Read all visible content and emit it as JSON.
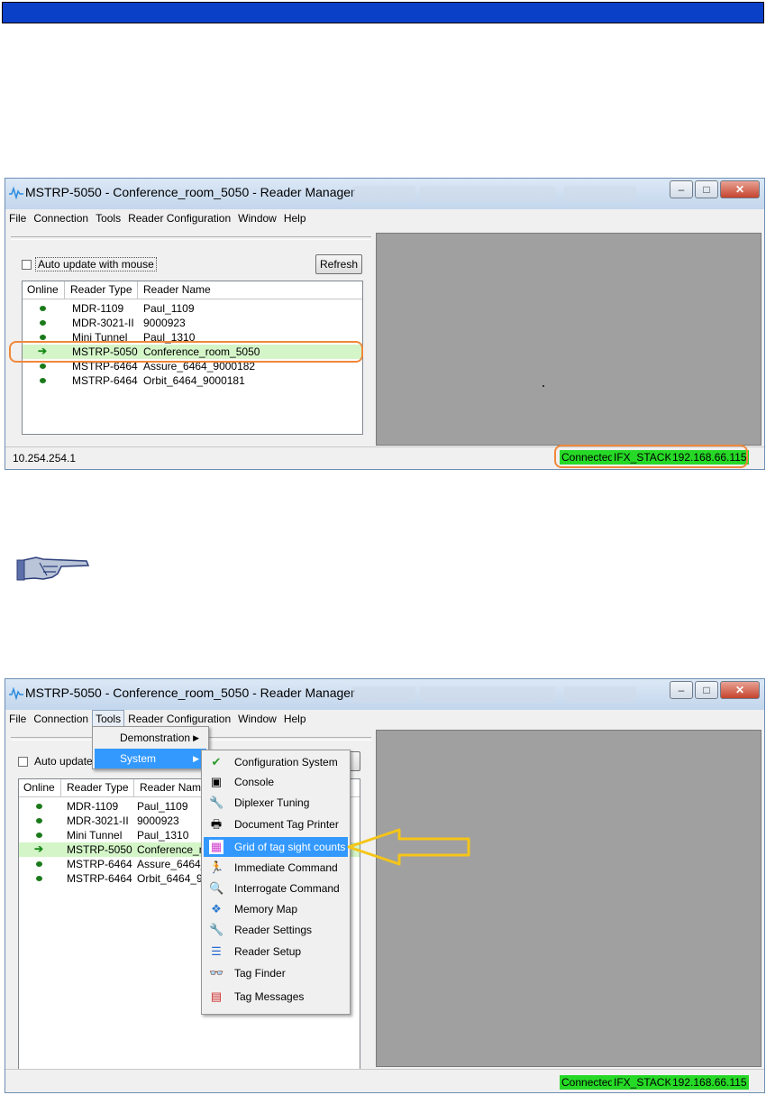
{
  "window": {
    "title": "MSTRP-5050 - Conference_room_5050 - Reader Manager",
    "menu": [
      "File",
      "Connection",
      "Tools",
      "Reader Configuration",
      "Window",
      "Help"
    ],
    "minimize": "–",
    "maximize": "□",
    "close": "✕"
  },
  "panel": {
    "auto_update_label": "Auto update with mouse",
    "auto_update_short": "Auto update",
    "refresh_label": "Refresh",
    "columns": [
      "Online",
      "Reader Type",
      "Reader Name"
    ]
  },
  "readers": [
    {
      "type": "MDR-1109",
      "name": "Paul_1109",
      "short": "Paul_1109",
      "status": "online"
    },
    {
      "type": "MDR-3021-II",
      "name": "9000923",
      "short": "9000923",
      "status": "online"
    },
    {
      "type": "Mini Tunnel",
      "name": "Paul_1310",
      "short": "Paul_1310",
      "status": "online"
    },
    {
      "type": "MSTRP-5050",
      "name": "Conference_room_5050",
      "short": "Conference_ro",
      "status": "connected"
    },
    {
      "type": "MSTRP-6464",
      "name": "Assure_6464_9000182",
      "short": "Assure_6464_!",
      "status": "online"
    },
    {
      "type": "MSTRP-6464",
      "name": "Orbit_6464_9000181",
      "short": "Orbit_6464_90",
      "status": "online"
    }
  ],
  "status_bar": {
    "ip": "10.254.254.1",
    "connected": "Connected",
    "stack": "IFX_STACK",
    "reader_ip": "192.168.66.115"
  },
  "tools_menu": {
    "items": [
      "Demonstration",
      "System"
    ],
    "system_items": [
      {
        "label": "Configuration System",
        "icon": "configuration-icon",
        "glyph": "✔"
      },
      {
        "label": "Console",
        "icon": "console-icon",
        "glyph": "▣"
      },
      {
        "label": "Diplexer Tuning",
        "icon": "wrench-icon",
        "glyph": "🔧"
      },
      {
        "label": "Document Tag Printer",
        "icon": "printer-icon",
        "glyph": "🖶"
      },
      {
        "label": "Grid of tag sight counts",
        "icon": "grid-icon",
        "glyph": "▦"
      },
      {
        "label": "Immediate Command",
        "icon": "runner-icon",
        "glyph": "🏃"
      },
      {
        "label": "Interrogate Command",
        "icon": "magnifier-icon",
        "glyph": "🔍"
      },
      {
        "label": "Memory Map",
        "icon": "memory-map-icon",
        "glyph": "❖"
      },
      {
        "label": "Reader Settings",
        "icon": "wrench-icon",
        "glyph": "🔧"
      },
      {
        "label": "Reader Setup",
        "icon": "list-icon",
        "glyph": "☰"
      },
      {
        "label": "Tag Finder",
        "icon": "binoculars-icon",
        "glyph": "👓"
      },
      {
        "label": "Tag Messages",
        "icon": "messages-icon",
        "glyph": "▤"
      }
    ]
  },
  "colors": {
    "header_bar": "#0a3fc8",
    "status_green": "#26d926",
    "highlight_orange": "#f0883a",
    "callout_arrow": "#f5c518",
    "menu_highlight": "#3399ff"
  }
}
